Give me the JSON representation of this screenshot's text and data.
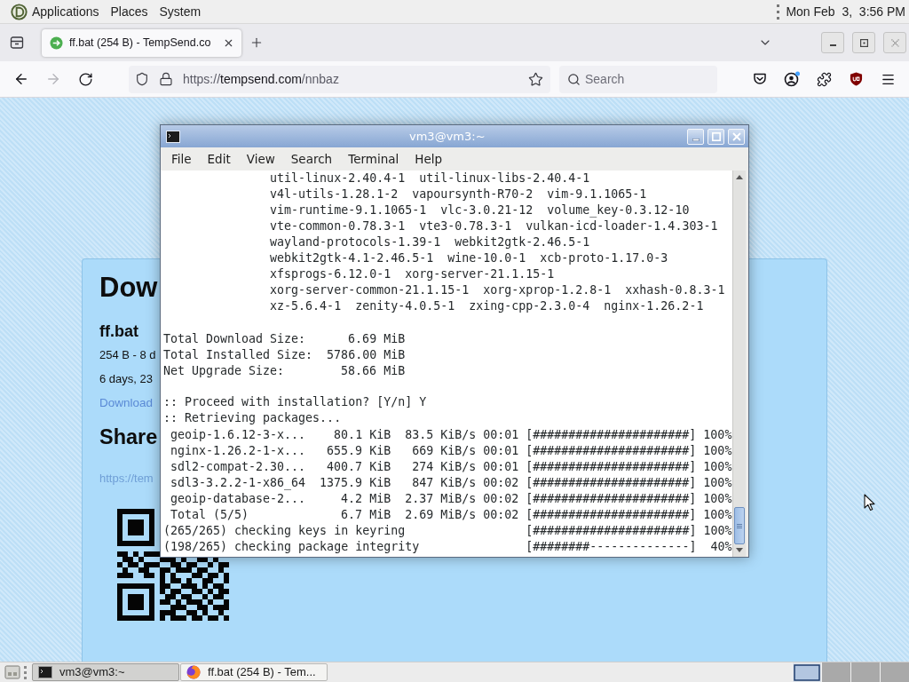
{
  "top_panel": {
    "menus": [
      "Applications",
      "Places",
      "System"
    ],
    "clock": "Mon Feb  3,  3:56 PM"
  },
  "browser": {
    "tabs": [
      {
        "title": "ff.bat (254 B) - TempSend.co",
        "selected": true
      }
    ],
    "forward_disabled": true,
    "url": {
      "scheme": "https://",
      "host": "tempsend.com",
      "path": "/nnbaz"
    },
    "search": {
      "placeholder": "Search"
    },
    "page": {
      "heading": "Dow",
      "file_name": "ff.bat",
      "file_info": "254 B - 8 d",
      "expiry": "6 days, 23",
      "download_link": "Download",
      "share_heading": "Share",
      "share_link": "https://tem"
    }
  },
  "terminal": {
    "title": "vm3@vm3:~",
    "menus": [
      "File",
      "Edit",
      "View",
      "Search",
      "Terminal",
      "Help"
    ],
    "package_lines": [
      [
        "util-linux-2.40.4-1",
        "util-linux-libs-2.40.4-1"
      ],
      [
        "v4l-utils-1.28.1-2",
        "vapoursynth-R70-2",
        "vim-9.1.1065-1"
      ],
      [
        "vim-runtime-9.1.1065-1",
        "vlc-3.0.21-12",
        "volume_key-0.3.12-10"
      ],
      [
        "vte-common-0.78.3-1",
        "vte3-0.78.3-1",
        "vulkan-icd-loader-1.4.303-1"
      ],
      [
        "wayland-protocols-1.39-1",
        "webkit2gtk-2.46.5-1"
      ],
      [
        "webkit2gtk-4.1-2.46.5-1",
        "wine-10.0-1",
        "xcb-proto-1.17.0-3"
      ],
      [
        "xfsprogs-6.12.0-1",
        "xorg-server-21.1.15-1"
      ],
      [
        "xorg-server-common-21.1.15-1",
        "xorg-xprop-1.2.8-1",
        "xxhash-0.8.3-1"
      ],
      [
        "xz-5.6.4-1",
        "zenity-4.0.5-1",
        "zxing-cpp-2.3.0-4",
        "nginx-1.26.2-1"
      ]
    ],
    "summary": [
      {
        "label": "Total Download Size:",
        "value": "6.69 MiB"
      },
      {
        "label": "Total Installed Size:",
        "value": "5786.00 MiB"
      },
      {
        "label": "Net Upgrade Size:",
        "value": "58.66 MiB"
      }
    ],
    "messages": [
      ":: Proceed with installation? [Y/n] Y",
      ":: Retrieving packages..."
    ],
    "downloads": [
      {
        "name": "geoip-1.6.12-3-x...",
        "size": "80.1 KiB",
        "rate": "83.5 KiB/s",
        "time": "00:01",
        "bar": "[######################]",
        "percent": "100%"
      },
      {
        "name": "nginx-1.26.2-1-x...",
        "size": "655.9 KiB",
        "rate": "669 KiB/s",
        "time": "00:01",
        "bar": "[######################]",
        "percent": "100%"
      },
      {
        "name": "sdl2-compat-2.30...",
        "size": "400.7 KiB",
        "rate": "274 KiB/s",
        "time": "00:01",
        "bar": "[######################]",
        "percent": "100%"
      },
      {
        "name": "sdl3-3.2.2-1-x86_64",
        "size": "1375.9 KiB",
        "rate": "847 KiB/s",
        "time": "00:02",
        "bar": "[######################]",
        "percent": "100%"
      },
      {
        "name": "geoip-database-2...",
        "size": "4.2 MiB",
        "rate": "2.37 MiB/s",
        "time": "00:02",
        "bar": "[######################]",
        "percent": "100%"
      },
      {
        "name": "Total (5/5)",
        "size": "6.7 MiB",
        "rate": "2.69 MiB/s",
        "time": "00:02",
        "bar": "[######################]",
        "percent": "100%"
      }
    ],
    "checks": [
      {
        "label": "(265/265) checking keys in keyring",
        "bar": "[######################]",
        "percent": "100%"
      },
      {
        "label": "(198/265) checking package integrity",
        "bar": "[########--------------]",
        "percent": "40%"
      }
    ]
  },
  "taskbar": {
    "tasks": [
      {
        "label": "vm3@vm3:~",
        "kind": "terminal",
        "selected": true
      },
      {
        "label": "ff.bat (254 B) - Tem...",
        "kind": "browser",
        "selected": false
      }
    ],
    "workspaces": [
      {
        "selected": true
      },
      {
        "selected": false
      },
      {
        "selected": false
      },
      {
        "selected": false
      }
    ]
  }
}
